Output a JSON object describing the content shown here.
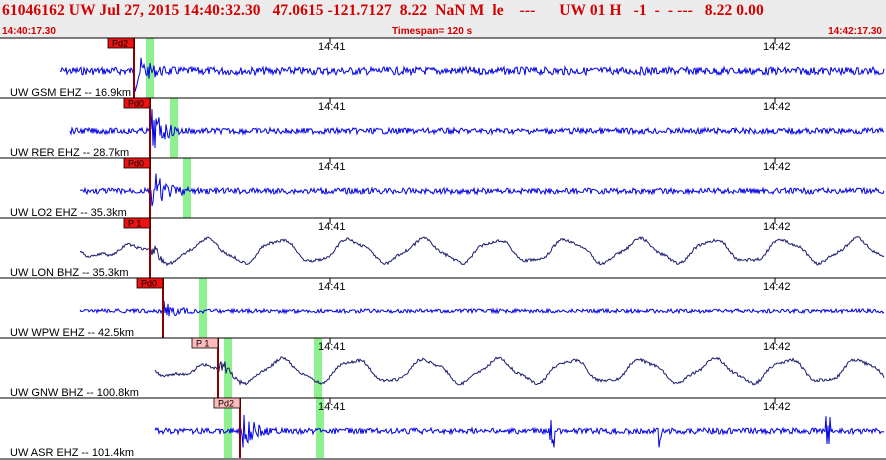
{
  "header": {
    "event_line": "61046162 UW Jul 27, 2015 14:40:32.30   47.0615 -121.7127  8.22  NaN M  le    ---      UW 01 H   -1  -  - ---   8.22 0.00"
  },
  "subheader": {
    "start_time": "14:40:17.30",
    "timespan": "Timespan= 120 s",
    "end_time": "14:42:17.30"
  },
  "time_marks": [
    "14:41",
    "14:42"
  ],
  "colors": {
    "header_text": "#d40000",
    "trace_blue": "#0000e6",
    "trace_navy": "#1c1c6e",
    "pick_red": "#ee1111",
    "pick_pink": "#ffbbbb",
    "marker_green": "#8ef08e"
  },
  "traces": [
    {
      "label": "UW GSM EHZ -- 16.9km",
      "pick": "Pd2",
      "pick_style": "red",
      "color": "blue",
      "type": "hf"
    },
    {
      "label": "UW RER EHZ -- 28.7km",
      "pick": "Pd0",
      "pick_style": "red",
      "color": "blue",
      "type": "hf"
    },
    {
      "label": "UW LO2 EHZ -- 35.3km",
      "pick": "Pd0",
      "pick_style": "red",
      "color": "blue",
      "type": "hf"
    },
    {
      "label": "UW LON BHZ -- 35.3km",
      "pick": "P 1",
      "pick_style": "red",
      "color": "navy",
      "type": "lf"
    },
    {
      "label": "UW WPW EHZ -- 42.5km",
      "pick": "Pd0",
      "pick_style": "red",
      "color": "blue",
      "type": "hf"
    },
    {
      "label": "UW GNW BHZ -- 100.8km",
      "pick": "P 1",
      "pick_style": "pink",
      "color": "navy",
      "type": "lf"
    },
    {
      "label": "UW ASR EHZ -- 101.4km",
      "pick": "Pd2",
      "pick_style": "pink",
      "color": "blue",
      "type": "hf"
    }
  ]
}
